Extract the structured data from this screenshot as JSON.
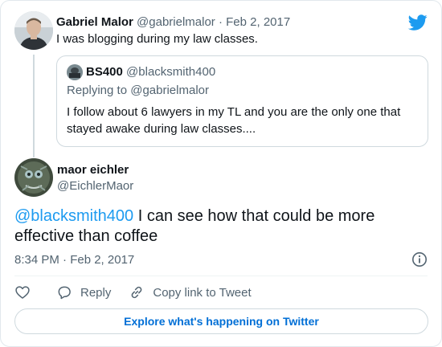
{
  "parent_tweet": {
    "name": "Gabriel Malor",
    "handle": "@gabrielmalor",
    "separator": " · ",
    "date": "Feb 2, 2017",
    "text": "I was blogging during my law classes."
  },
  "quoted_tweet": {
    "name": "BS400",
    "handle": "@blacksmith400",
    "reply_prefix": "Replying to ",
    "reply_handle": "@gabrielmalor",
    "text": "I follow about 6 lawyers in my TL and you are the only one that stayed awake during law classes...."
  },
  "main_tweet": {
    "name": "maor eichler",
    "handle": "@EichlerMaor",
    "mention": "@blacksmith400",
    "text": " I can see how that could be more effective than coffee",
    "timestamp": "8:34 PM · Feb 2, 2017"
  },
  "actions": {
    "like_icon": "heart-icon",
    "reply_label": "Reply",
    "copy_link_label": "Copy link to Tweet"
  },
  "explore_label": "Explore what's happening on Twitter",
  "colors": {
    "accent": "#1d9bf0",
    "link_button": "#006fd6",
    "muted": "#536471",
    "border": "#cfd9de"
  }
}
